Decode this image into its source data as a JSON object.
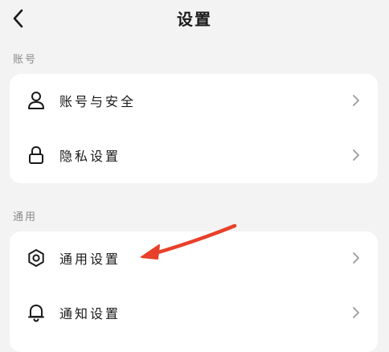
{
  "header": {
    "title": "设置",
    "back_icon": "back-arrow-icon"
  },
  "sections": [
    {
      "label": "账号",
      "items": [
        {
          "label": "账号与安全",
          "icon": "user-icon"
        },
        {
          "label": "隐私设置",
          "icon": "lock-icon"
        }
      ]
    },
    {
      "label": "通用",
      "items": [
        {
          "label": "通用设置",
          "icon": "gear-icon"
        },
        {
          "label": "通知设置",
          "icon": "bell-icon"
        }
      ]
    }
  ],
  "colors": {
    "background": "#f3f3f3",
    "card": "#ffffff",
    "annotation_arrow": "#e8402a"
  }
}
